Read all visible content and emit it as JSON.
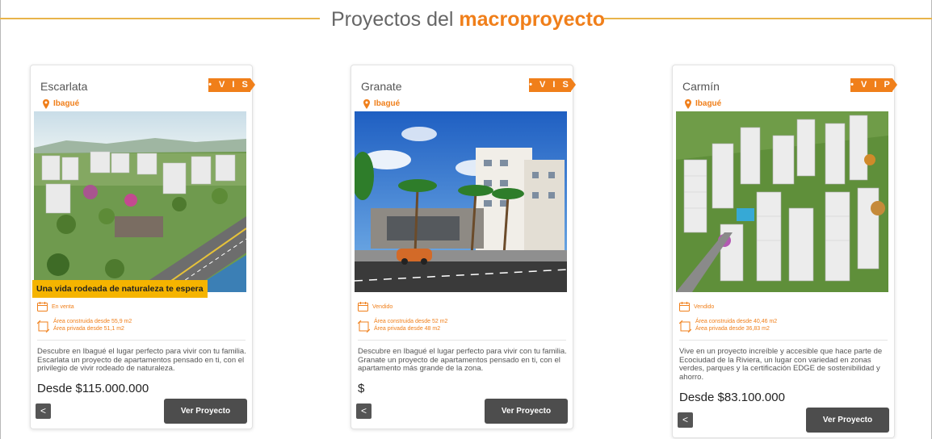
{
  "section": {
    "title_prefix": "Proyectos del ",
    "title_highlight": "macroproyecto"
  },
  "projects": [
    {
      "name": "Escarlata",
      "badge": "• V I S •",
      "location": "Ibagué",
      "tagline": "Una vida rodeada de naturaleza te espera",
      "status": "En venta",
      "area_built": "Área construida desde 55,9 m2",
      "area_private": "Área privada desde 51,1 m2",
      "description": "Descubre en Ibagué el lugar perfecto para vivir con tu familia. Escarlata un proyecto de apartamentos pensado en ti, con el privilegio de vivir rodeado de naturaleza.",
      "price": "Desde $115.000.000",
      "button_label": "Ver Proyecto"
    },
    {
      "name": "Granate",
      "badge": "• V I S •",
      "location": "Ibagué",
      "status": "Vendido",
      "area_built": "Área construida desde 52 m2",
      "area_private": "Área privada desde 48 m2",
      "description": "Descubre en Ibagué el lugar perfecto para vivir con tu familia. Granate un proyecto de apartamentos pensado en ti, con el apartamento más grande de la zona.",
      "price": "$",
      "button_label": "Ver Proyecto"
    },
    {
      "name": "Carmín",
      "badge": "• V I P •",
      "location": "Ibagué",
      "status": "Vendido",
      "area_built": "Área construida desde 40,46 m2",
      "area_private": "Área privada desde 36,83 m2",
      "description": "Vive en un proyecto increíble y accesible que hace parte de Ecociudad de la Riviera, un lugar con variedad en zonas verdes, parques y la certificación EDGE de sostenibilidad y ahorro.",
      "price": "Desde $83.100.000",
      "button_label": "Ver Proyecto"
    }
  ],
  "colors": {
    "accent": "#f07f1a",
    "line": "#e8b44a",
    "tagline_bg": "#f5b400",
    "button": "#4d4d4d"
  },
  "icons": [
    "map-pin-icon",
    "calendar-icon",
    "area-icon",
    "share-icon"
  ]
}
